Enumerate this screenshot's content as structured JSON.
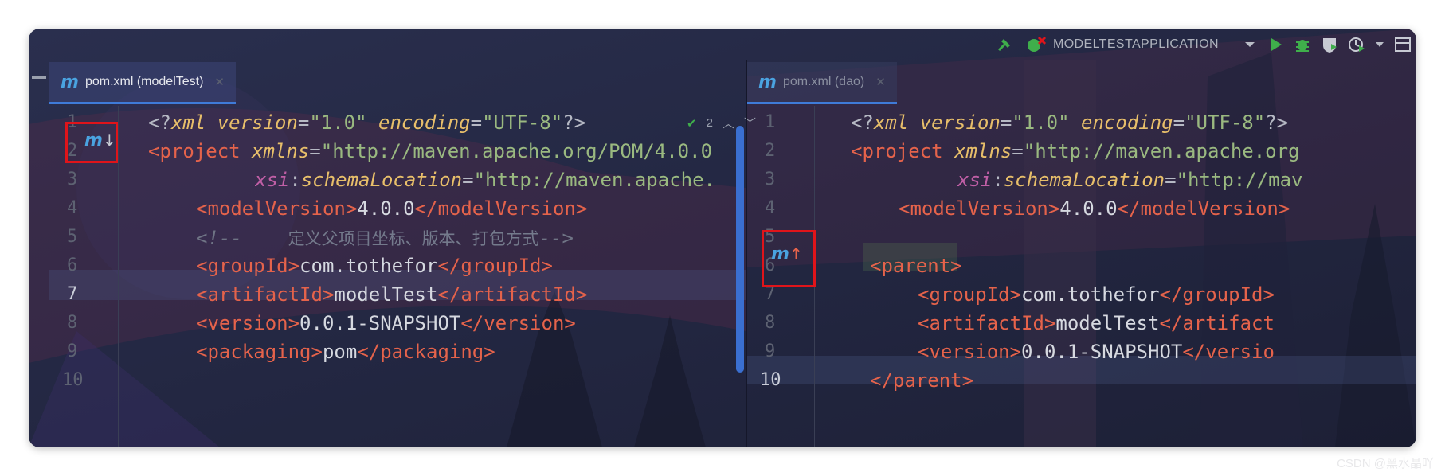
{
  "toolbar": {
    "run_config": "MODELTESTAPPLICATION"
  },
  "tabs": {
    "left": {
      "label": "pom.xml (modelTest)",
      "icon": "maven-m-icon"
    },
    "right": {
      "label": "pom.xml (dao)",
      "icon": "maven-m-icon"
    }
  },
  "inspection": {
    "count": "2"
  },
  "left_editor": {
    "line_numbers": [
      "1",
      "2",
      "3",
      "4",
      "5",
      "6",
      "7",
      "8",
      "9",
      "10"
    ],
    "current_line": "7"
  },
  "right_editor": {
    "line_numbers": [
      "1",
      "2",
      "3",
      "4",
      "5",
      "6",
      "7",
      "8",
      "9",
      "10"
    ],
    "current_line": "10"
  },
  "watermark": "CSDN @黑水晶吖",
  "colors": {
    "tag": "#e5634b",
    "attribute": "#e8bf6a",
    "string": "#9ab980",
    "namespace": "#c05fa6",
    "comment": "#6f7485",
    "highlight_box": "#e0141a",
    "maven_icon": "#4aa3e0"
  }
}
